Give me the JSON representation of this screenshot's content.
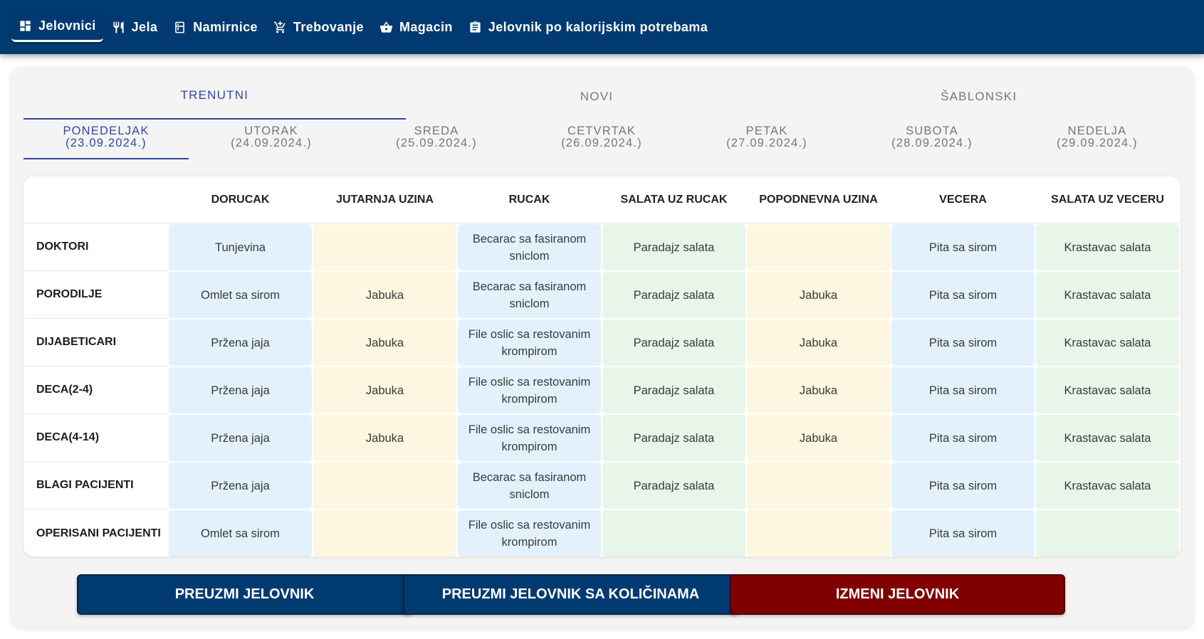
{
  "nav": {
    "items": [
      {
        "label": "Jelovnici",
        "icon": "dashboard-icon",
        "active": true
      },
      {
        "label": "Jela",
        "icon": "utensils-icon",
        "active": false
      },
      {
        "label": "Namirnice",
        "icon": "kitchen-icon",
        "active": false
      },
      {
        "label": "Trebovanje",
        "icon": "cart-icon",
        "active": false
      },
      {
        "label": "Magacin",
        "icon": "basket-icon",
        "active": false
      },
      {
        "label": "Jelovnik po kalorijskim potrebama",
        "icon": "clipboard-icon",
        "active": false
      }
    ]
  },
  "tabs": [
    "TRENUTNI",
    "NOVI",
    "ŠABLONSKI"
  ],
  "days": [
    {
      "name": "PONEDELJAK",
      "date": "(23.09.2024.)"
    },
    {
      "name": "UTORAK",
      "date": "(24.09.2024.)"
    },
    {
      "name": "SREDA",
      "date": "(25.09.2024.)"
    },
    {
      "name": "CETVRTAK",
      "date": "(26.09.2024.)"
    },
    {
      "name": "PETAK",
      "date": "(27.09.2024.)"
    },
    {
      "name": "SUBOTA",
      "date": "(28.09.2024.)"
    },
    {
      "name": "NEDELJA",
      "date": "(29.09.2024.)"
    }
  ],
  "table": {
    "columns": [
      "DORUCAK",
      "JUTARNJA UZINA",
      "RUCAK",
      "SALATA UZ RUCAK",
      "POPODNEVNA UZINA",
      "VECERA",
      "SALATA UZ VECERU"
    ],
    "rows": [
      {
        "label": "DOKTORI",
        "cells": [
          "Tunjevina",
          "",
          "Becarac sa fasiranom sniclom",
          "Paradajz salata",
          "",
          "Pita sa sirom",
          "Krastavac salata"
        ]
      },
      {
        "label": "PORODILJE",
        "cells": [
          "Omlet sa sirom",
          "Jabuka",
          "Becarac sa fasiranom sniclom",
          "Paradajz salata",
          "Jabuka",
          "Pita sa sirom",
          "Krastavac salata"
        ]
      },
      {
        "label": "DIJABETICARI",
        "cells": [
          "Pržena jaja",
          "Jabuka",
          "File oslic sa restovanim krompirom",
          "Paradajz salata",
          "Jabuka",
          "Pita sa sirom",
          "Krastavac salata"
        ]
      },
      {
        "label": "DECA(2-4)",
        "cells": [
          "Pržena jaja",
          "Jabuka",
          "File oslic sa restovanim krompirom",
          "Paradajz salata",
          "Jabuka",
          "Pita sa sirom",
          "Krastavac salata"
        ]
      },
      {
        "label": "DECA(4-14)",
        "cells": [
          "Pržena jaja",
          "Jabuka",
          "File oslic sa restovanim krompirom",
          "Paradajz salata",
          "Jabuka",
          "Pita sa sirom",
          "Krastavac salata"
        ]
      },
      {
        "label": "BLAGI PACIJENTI",
        "cells": [
          "Pržena jaja",
          "",
          "Becarac sa fasiranom sniclom",
          "Paradajz salata",
          "",
          "Pita sa sirom",
          "Krastavac salata"
        ]
      },
      {
        "label": "OPERISANI PACIJENTI",
        "cells": [
          "Omlet sa sirom",
          "",
          "File oslic sa restovanim krompirom",
          "",
          "",
          "Pita sa sirom",
          ""
        ]
      }
    ]
  },
  "buttons": {
    "download": "PREUZMI JELOVNIK",
    "download_qty": "PREUZMI JELOVNIK SA KOLIČINAMA",
    "edit": "IZMENI JELOVNIK"
  },
  "colors": {
    "nav_bg": "#003a70",
    "accent": "#34479a",
    "breakfast_dinner_bg": "#e3f1fd",
    "snack_bg": "#fdf6e0",
    "salad_bg": "#e8f5e9",
    "edit_button": "#800000"
  }
}
